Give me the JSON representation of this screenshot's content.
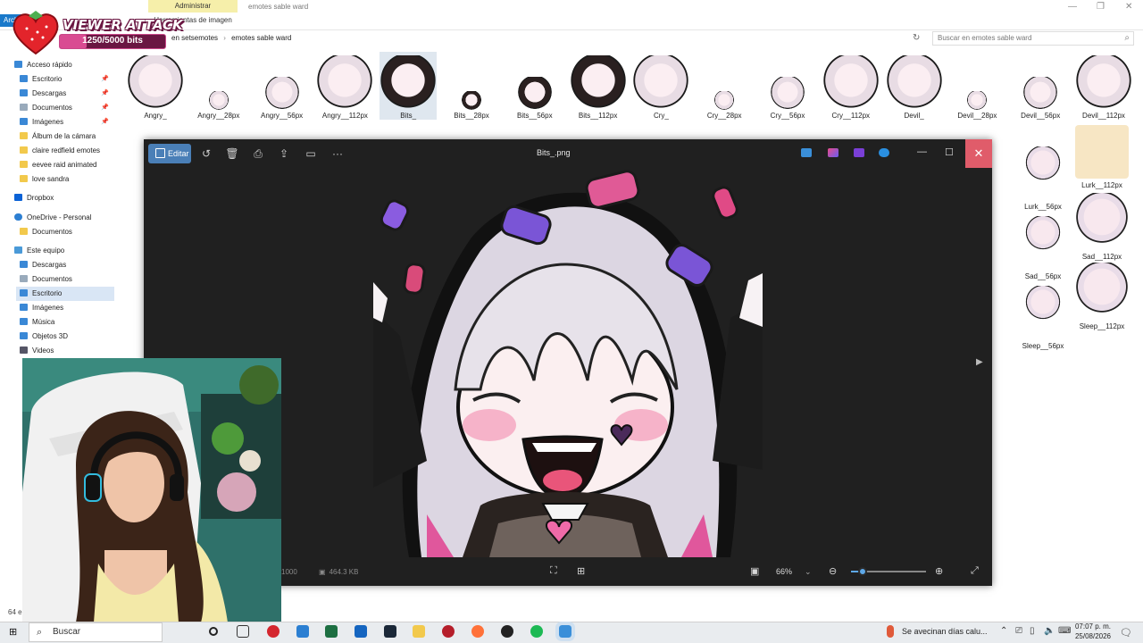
{
  "explorer": {
    "window_title": "emotes sable ward",
    "ribbon_context_tab": "Administrar",
    "ribbon_context_sub": "Herramientas de imagen",
    "file_tab": "Archivo",
    "breadcrumb": [
      "en setsemotes",
      "emotes sable ward"
    ],
    "search_placeholder": "Buscar en emotes sable ward",
    "status_left": "64 e",
    "nav": {
      "quick_access": "Acceso rápido",
      "items": [
        {
          "label": "Escritorio",
          "icon": "desktop-icon",
          "pinned": true
        },
        {
          "label": "Descargas",
          "icon": "download-icon",
          "pinned": true
        },
        {
          "label": "Documentos",
          "icon": "document-icon",
          "pinned": true
        },
        {
          "label": "Imágenes",
          "icon": "image-icon",
          "pinned": true
        },
        {
          "label": "Álbum de la cámara",
          "icon": "folder-icon"
        },
        {
          "label": "claire redfield emotes",
          "icon": "folder-icon"
        },
        {
          "label": "eevee raid animated",
          "icon": "folder-icon"
        },
        {
          "label": "love sandra",
          "icon": "folder-icon"
        }
      ],
      "dropbox": "Dropbox",
      "onedrive": "OneDrive - Personal",
      "onedrive_items": [
        "Documentos"
      ],
      "this_pc": "Este equipo",
      "pc_items": [
        "Descargas",
        "Documentos",
        "Escritorio",
        "Imágenes",
        "Música",
        "Objetos 3D",
        "Videos"
      ]
    },
    "row1_files": [
      "Angry_",
      "Angry__28px",
      "Angry__56px",
      "Angry__112px",
      "Bits_",
      "Bits__28px",
      "Bits__56px",
      "Bits__112px",
      "Cry_",
      "Cry__28px",
      "Cry__56px",
      "Cry__112px",
      "Devil_",
      "Devil__28px",
      "Devil__56px",
      "Devil__112px"
    ],
    "right_files": [
      "Lurk__56px",
      "Lurk__112px",
      "Sad__56px",
      "Sad__112px",
      "Sleep__56px",
      "Sleep__112px"
    ]
  },
  "stream_overlay": {
    "title": "VIEWER ATTACK",
    "current": 1250,
    "goal": 5000,
    "count_label": "1250/5000 bits",
    "progress_fraction": 0.25
  },
  "photo_viewer": {
    "edit_label": "Editar",
    "file_name": "Bits_.png",
    "dimensions_partial": "1000",
    "file_size": "464.3 KB",
    "zoom": "66%",
    "zoom_fraction": 0.16
  },
  "taskbar": {
    "search_label": "Buscar",
    "weather": "Se avecinan días calu...",
    "time": "07:07 p. m.",
    "date": "25/08/2026"
  }
}
